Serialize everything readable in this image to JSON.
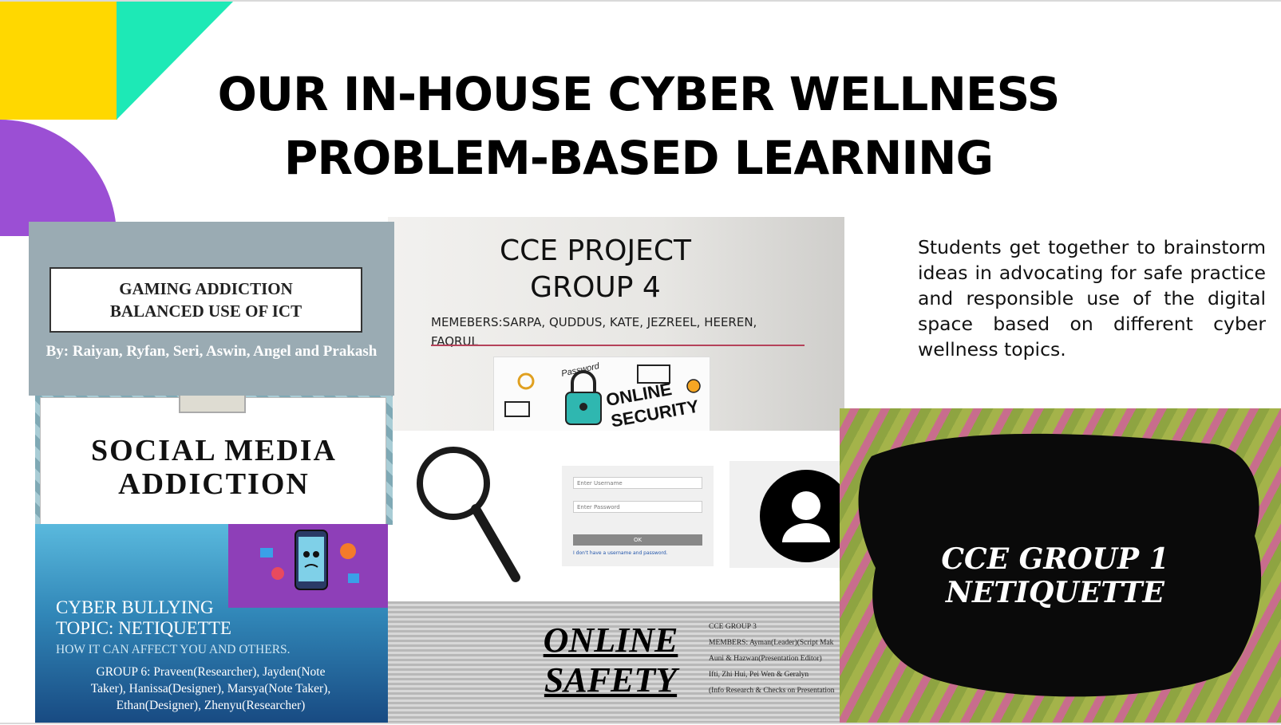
{
  "slide": {
    "title_line1": "OUR IN-HOUSE CYBER WELLNESS",
    "title_line2": "PROBLEM-BASED LEARNING",
    "description": "Students get together to brainstorm ideas in advocating for safe practice and responsible use of the digital space based on different cyber wellness topics.",
    "colors": {
      "yellow": "#FFD800",
      "teal": "#1DE9B6",
      "purple": "#9B4FD4"
    }
  },
  "thumbnails": {
    "gaming": {
      "title_line1": "GAMING ADDICTION",
      "title_line2": "BALANCED USE OF ICT",
      "authors": "By: Raiyan, Ryfan, Seri, Aswin, Angel and Prakash"
    },
    "group4": {
      "title_line1": "CCE PROJECT",
      "title_line2": "GROUP 4",
      "members_line1": "MEMEBERS:SARPA, QUDDUS, KATE, JEZREEL, HEEREN,",
      "members_line2": "FAQRUL",
      "image_text_1": "Password",
      "image_text_2": "ONLINE",
      "image_text_3": "SECURITY"
    },
    "social": {
      "title_line1": "SOCIAL MEDIA",
      "title_line2": "ADDICTION"
    },
    "bullying": {
      "title_line1": "CYBER BULLYING",
      "title_line2": "TOPIC: NETIQUETTE",
      "subtitle": "HOW IT CAN AFFECT YOU AND OTHERS.",
      "group_line1": "GROUP 6: Praveen(Researcher), Jayden(Note",
      "group_line2": "Taker), Hanissa(Designer), Marsya(Note Taker),",
      "group_line3": "Ethan(Designer),  Zhenyu(Researcher)"
    },
    "login": {
      "username_placeholder": "Enter Username",
      "password_placeholder": "Enter Password",
      "ok_label": "OK",
      "link_text": "I don't have a username and password."
    },
    "safety": {
      "title_line1": "ONLINE",
      "title_line2": "SAFETY",
      "info_line1": "CCE GROUP 3",
      "info_line2": "MEMBERS: Ayman(Leader)(Script Mak",
      "info_line3": "Auni & Hazwan(Presentation Editor)",
      "info_line4": "Ifti, Zhi Hui, Pei Wen & Geralyn",
      "info_line5": "(Info Research & Checks on Presentation"
    },
    "netiquette": {
      "title_line1": "CCE GROUP 1",
      "title_line2": "NETIQUETTE"
    }
  }
}
